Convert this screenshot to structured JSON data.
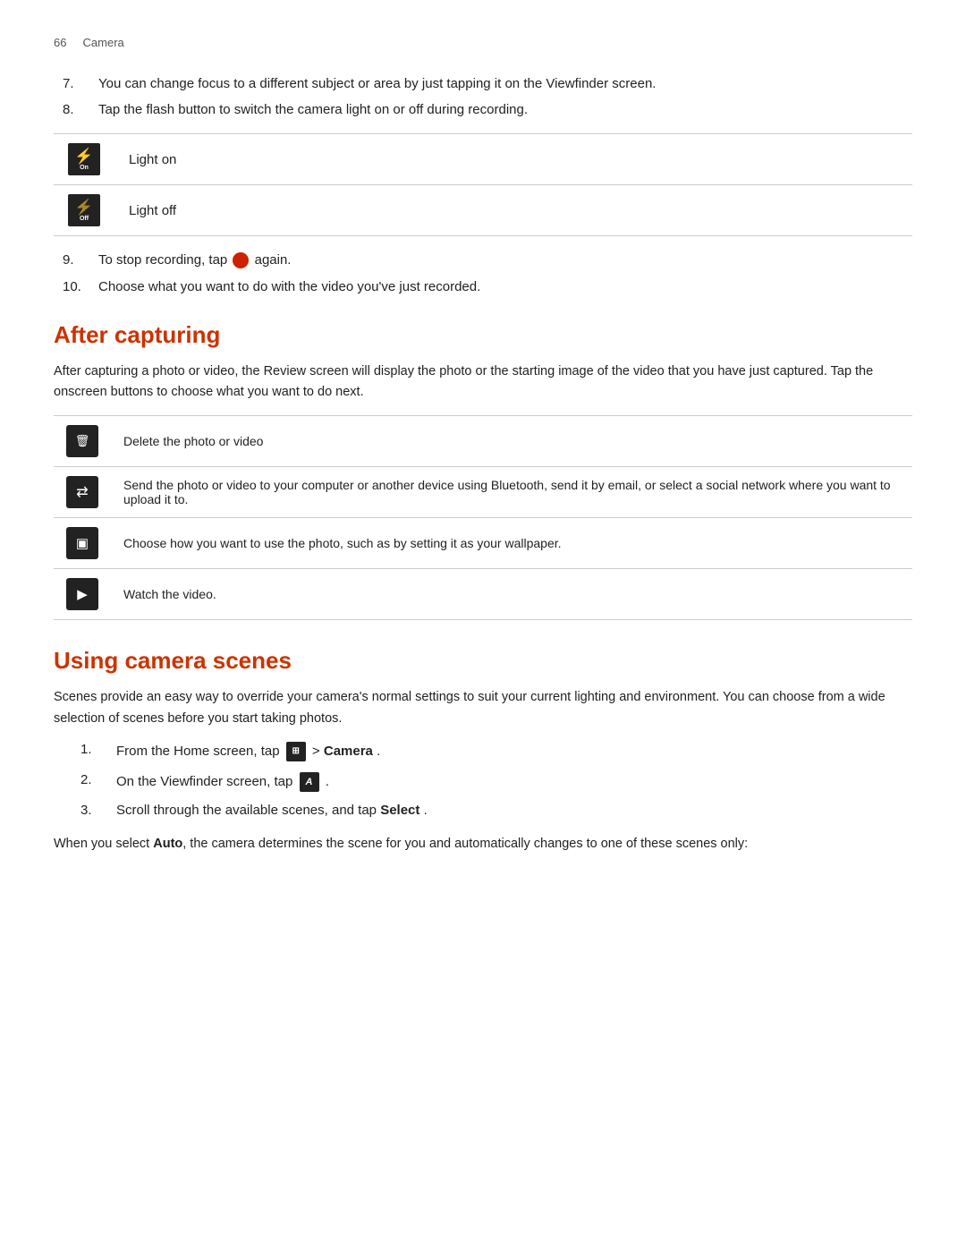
{
  "header": {
    "page_num": "66",
    "chapter": "Camera"
  },
  "section1": {
    "items": [
      {
        "num": "7.",
        "text": "You can change focus to a different subject or area by just tapping it on the Viewfinder screen."
      },
      {
        "num": "8.",
        "text": "Tap the flash button to switch the camera light on or off during recording."
      }
    ],
    "light_table": [
      {
        "icon_label": "⚡",
        "sub": "On",
        "description": "Light on"
      },
      {
        "icon_label": "⚡",
        "sub": "Off",
        "description": "Light off"
      }
    ],
    "items2": [
      {
        "num": "9.",
        "text_before": "To stop recording, tap",
        "text_after": "again."
      },
      {
        "num": "10.",
        "text": "Choose what you want to do with the video you've just recorded."
      }
    ]
  },
  "after_capturing": {
    "title": "After capturing",
    "intro": "After capturing a photo or video, the Review screen will display the photo or the starting image of the video that you have just captured. Tap the onscreen buttons to choose what you want to do next.",
    "actions": [
      {
        "icon": "🗑",
        "icon_label": "Delete",
        "text": "Delete the photo or video"
      },
      {
        "icon": "⇄",
        "icon_label": "Share",
        "text": "Send the photo or video to your computer or another device using Bluetooth, send it by email, or select a social network where you want to upload it to."
      },
      {
        "icon": "▣",
        "icon_label": "Set as",
        "text": "Choose how you want to use the photo, such as by setting it as your wallpaper."
      },
      {
        "icon": "▶",
        "icon_label": "Play",
        "text": "Watch the video."
      }
    ]
  },
  "using_camera_scenes": {
    "title": "Using camera scenes",
    "intro": "Scenes provide an easy way to override your camera's normal settings to suit your current lighting and environment. You can choose from a wide selection of scenes before you start taking photos.",
    "steps": [
      {
        "num": "1.",
        "text_before": "From the Home screen, tap",
        "icon": "⊞",
        "text_middle": "> ",
        "bold": "Camera",
        "text_after": "."
      },
      {
        "num": "2.",
        "text_before": "On the Viewfinder screen, tap",
        "icon": "A",
        "text_after": "."
      },
      {
        "num": "3.",
        "text_before": "Scroll through the available scenes, and tap",
        "bold": "Select",
        "text_after": "."
      }
    ],
    "auto_text_before": "When you select ",
    "auto_bold": "Auto",
    "auto_text_after": ", the camera determines the scene for you and automatically changes to one of these scenes only:"
  }
}
